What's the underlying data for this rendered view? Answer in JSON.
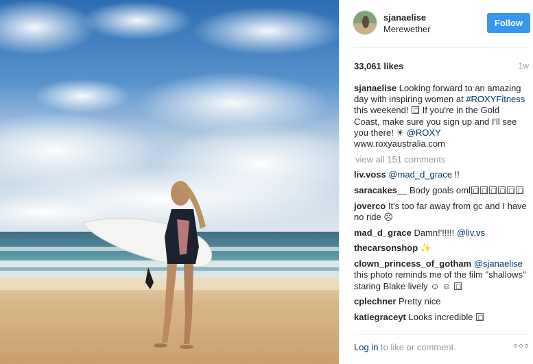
{
  "post": {
    "username": "sjanaelise",
    "location": "Merewether",
    "follow_label": "Follow",
    "likes": "33,061 likes",
    "time": "1w",
    "caption": {
      "user": "sjanaelise",
      "t1": " Looking forward to an amazing day with inspiring women at ",
      "hashtag": "#ROXYFitness",
      "t2": " this weekend! ",
      "t3": " If you're in the Gold Coast, make sure you sign up and I'll see you there! ",
      "sun": "☀",
      "mention": "@ROXY",
      "t4": " www.roxyaustralia.com"
    },
    "view_all": "view all 151 comments",
    "comments": [
      {
        "user": "liv.voss",
        "mention": "@mad_d_grace",
        "text": " !!"
      },
      {
        "user": "saracakes__",
        "text": " Body goals oml"
      },
      {
        "user": "joverco",
        "text": " It's too far away from gc and I have no ride ",
        "emoji": "☹"
      },
      {
        "user": "mad_d_grace",
        "text": " Damn!'!!!!! ",
        "mention": "@liv.vs"
      },
      {
        "user": "thecarsonshop",
        "emoji": " ✨"
      },
      {
        "user": "clown_princess_of_gotham",
        "mention": "@sjanaelise",
        "text": " this photo reminds me of the film \"shallows\" staring Blake lively ",
        "emoji": "☺ ☺"
      },
      {
        "user": "cplechner",
        "text": " Pretty nice"
      },
      {
        "user": "katiegraceyt",
        "text": " Looks incredible"
      }
    ],
    "login": {
      "link": "Log in",
      "rest": " to like or comment."
    }
  }
}
